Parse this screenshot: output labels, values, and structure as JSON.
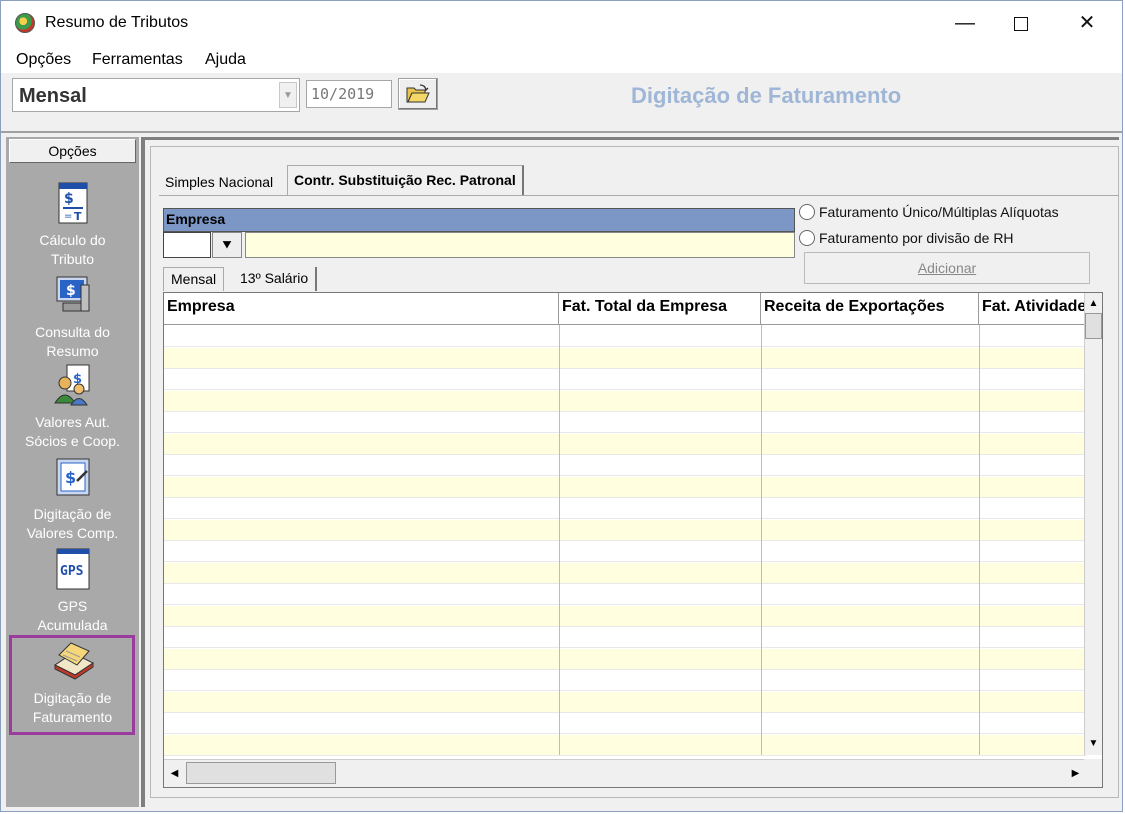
{
  "window": {
    "title": "Resumo de Tributos",
    "minimize": "—",
    "close": "✕"
  },
  "menu": [
    "Opções",
    "Ferramentas",
    "Ajuda"
  ],
  "toolbar": {
    "period": "Mensal",
    "date": "10/2019",
    "screen_title": "Digitação de Faturamento"
  },
  "sidebar": {
    "header": "Opções",
    "items": [
      {
        "line1": "Cálculo do",
        "line2": "Tributo",
        "icon": "calculation-icon"
      },
      {
        "line1": "Consulta do",
        "line2": "Resumo",
        "icon": "computer-money-icon"
      },
      {
        "line1": "Valores Aut.",
        "line2": "Sócios e  Coop.",
        "icon": "partners-money-icon"
      },
      {
        "line1": "Digitação de",
        "line2": "Valores Comp.",
        "icon": "money-edit-icon"
      },
      {
        "line1": "GPS",
        "line2": "Acumulada",
        "icon": "gps-icon"
      },
      {
        "line1": "Digitação de",
        "line2": "Faturamento",
        "icon": "billing-book-icon"
      }
    ]
  },
  "tabs": {
    "simples": "Simples Nacional",
    "contr": "Contr. Substituição Rec. Patronal"
  },
  "form": {
    "empresa_label": "Empresa",
    "dropdown_glyph": "⯆",
    "radio1": "Faturamento Único/Múltiplas Alíquotas",
    "radio2": "Faturamento por divisão de RH",
    "add_button": "Adicionar"
  },
  "subtabs": {
    "mensal": "Mensal",
    "decimo": "13º Salário"
  },
  "grid": {
    "columns": [
      "Empresa",
      "Fat. Total da Empresa",
      "Receita de Exportações",
      "Fat. Atividades"
    ],
    "row_count": 20
  },
  "colors": {
    "highlight": "#9b3b9e",
    "row_alt": "#ffffe0",
    "header_blue": "#7c97c6"
  }
}
